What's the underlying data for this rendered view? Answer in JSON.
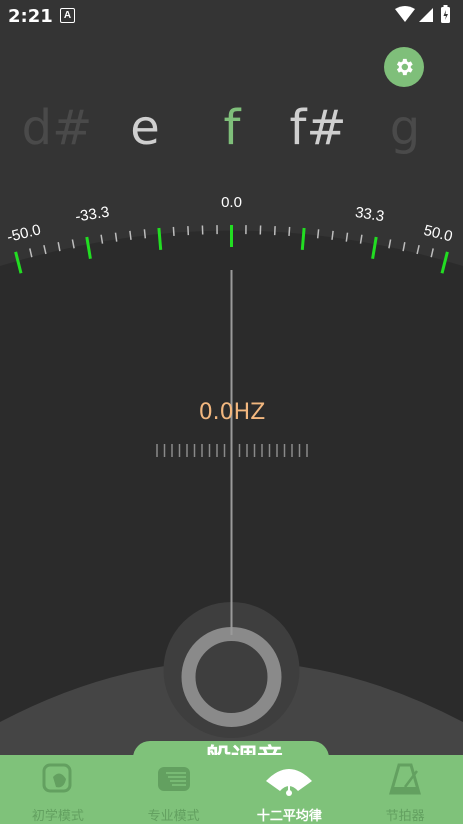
{
  "status_bar": {
    "time": "2:21",
    "notification_badge": "A"
  },
  "settings": {
    "icon": "gear-icon"
  },
  "notes": [
    {
      "label": "d#",
      "color": "#4a4a4a"
    },
    {
      "label": "e",
      "color": "#cfcfcf"
    },
    {
      "label": "f",
      "color": "#7fbf7a"
    },
    {
      "label": "f#",
      "color": "#cfcfcf"
    },
    {
      "label": "g",
      "color": "#4a4a4a"
    }
  ],
  "meter": {
    "scale_labels": [
      "-50.0",
      "-33.3",
      "0.0",
      "33.3",
      "50.0"
    ],
    "cents_range": [
      -50,
      50
    ],
    "needle_cents": 0.0,
    "frequency_text": "0.0HZ"
  },
  "mode_pill": {
    "label": "一般调音"
  },
  "nav": {
    "items": [
      {
        "label": "初学模式",
        "icon": "leaf-icon",
        "active": false
      },
      {
        "label": "专业模式",
        "icon": "board-icon",
        "active": false
      },
      {
        "label": "十二平均律",
        "icon": "gauge-icon",
        "active": true
      },
      {
        "label": "节拍器",
        "icon": "metronome-icon",
        "active": false
      }
    ]
  },
  "colors": {
    "accent": "#7fc27a",
    "tick_green": "#22dd22",
    "hz": "#f2b77f",
    "background": "#2e2e2e"
  }
}
